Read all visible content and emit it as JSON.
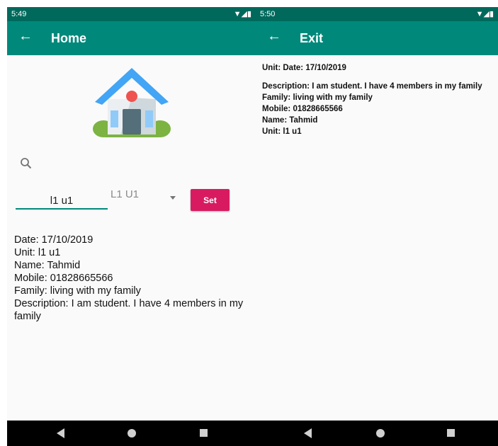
{
  "left_screen": {
    "status_bar": {
      "time": "5:49"
    },
    "app_bar": {
      "title": "Home"
    },
    "unit_input": {
      "value": "l1 u1"
    },
    "spinner": {
      "selected": "L1 U1"
    },
    "set_button": {
      "label": "Set"
    },
    "details": [
      "Date: 17/10/2019",
      "Unit: l1 u1",
      "Name: Tahmid",
      "Mobile: 01828665566",
      "Family: living with my family",
      "Description: I am student. I have 4 members in my family"
    ]
  },
  "right_screen": {
    "status_bar": {
      "time": "5:50"
    },
    "app_bar": {
      "title": "Exit"
    },
    "content": {
      "first_line": "Unit: Date: 17/10/2019",
      "lines": [
        "Description: I am student. I have 4 members in my family",
        "Family: living with my family",
        "Mobile: 01828665566",
        "Name: Tahmid",
        "Unit: l1 u1"
      ]
    }
  },
  "colors": {
    "status_bar": "#00695c",
    "app_bar": "#00897b",
    "accent": "#d81b60",
    "nav_bar": "#000000"
  },
  "icons": [
    "back-arrow-icon",
    "house-icon",
    "search-icon",
    "wifi-icon",
    "signal-icon",
    "battery-icon",
    "nav-back-icon",
    "nav-home-icon",
    "nav-recents-icon",
    "dropdown-caret-icon"
  ]
}
